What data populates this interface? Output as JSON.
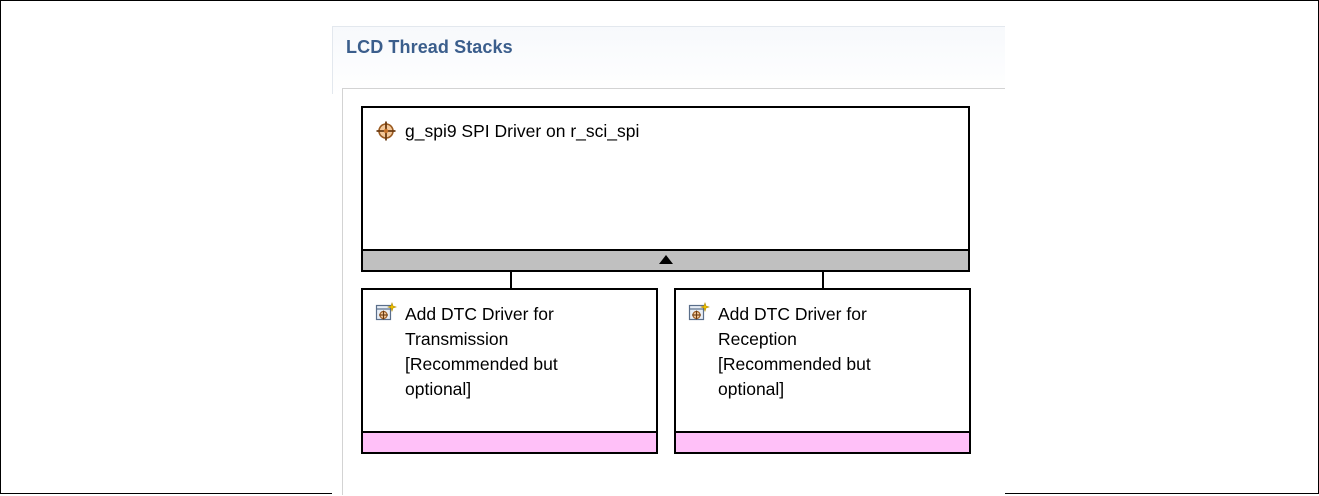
{
  "panel": {
    "title": "LCD Thread Stacks"
  },
  "modules": {
    "main": {
      "label": "g_spi9 SPI Driver on r_sci_spi",
      "icon": "driver-module-icon"
    },
    "children": [
      {
        "label": "Add DTC Driver for\nTransmission\n[Recommended but\noptional]",
        "icon": "add-component-icon"
      },
      {
        "label": "Add DTC Driver for\nReception\n[Recommended but\noptional]",
        "icon": "add-component-icon"
      }
    ]
  },
  "colors": {
    "title": "#3b5e8c",
    "expand_bar": "#c0c0c0",
    "optional_bar": "#ffc0f8",
    "border": "#000000",
    "icon_accent": "#c8742a"
  }
}
